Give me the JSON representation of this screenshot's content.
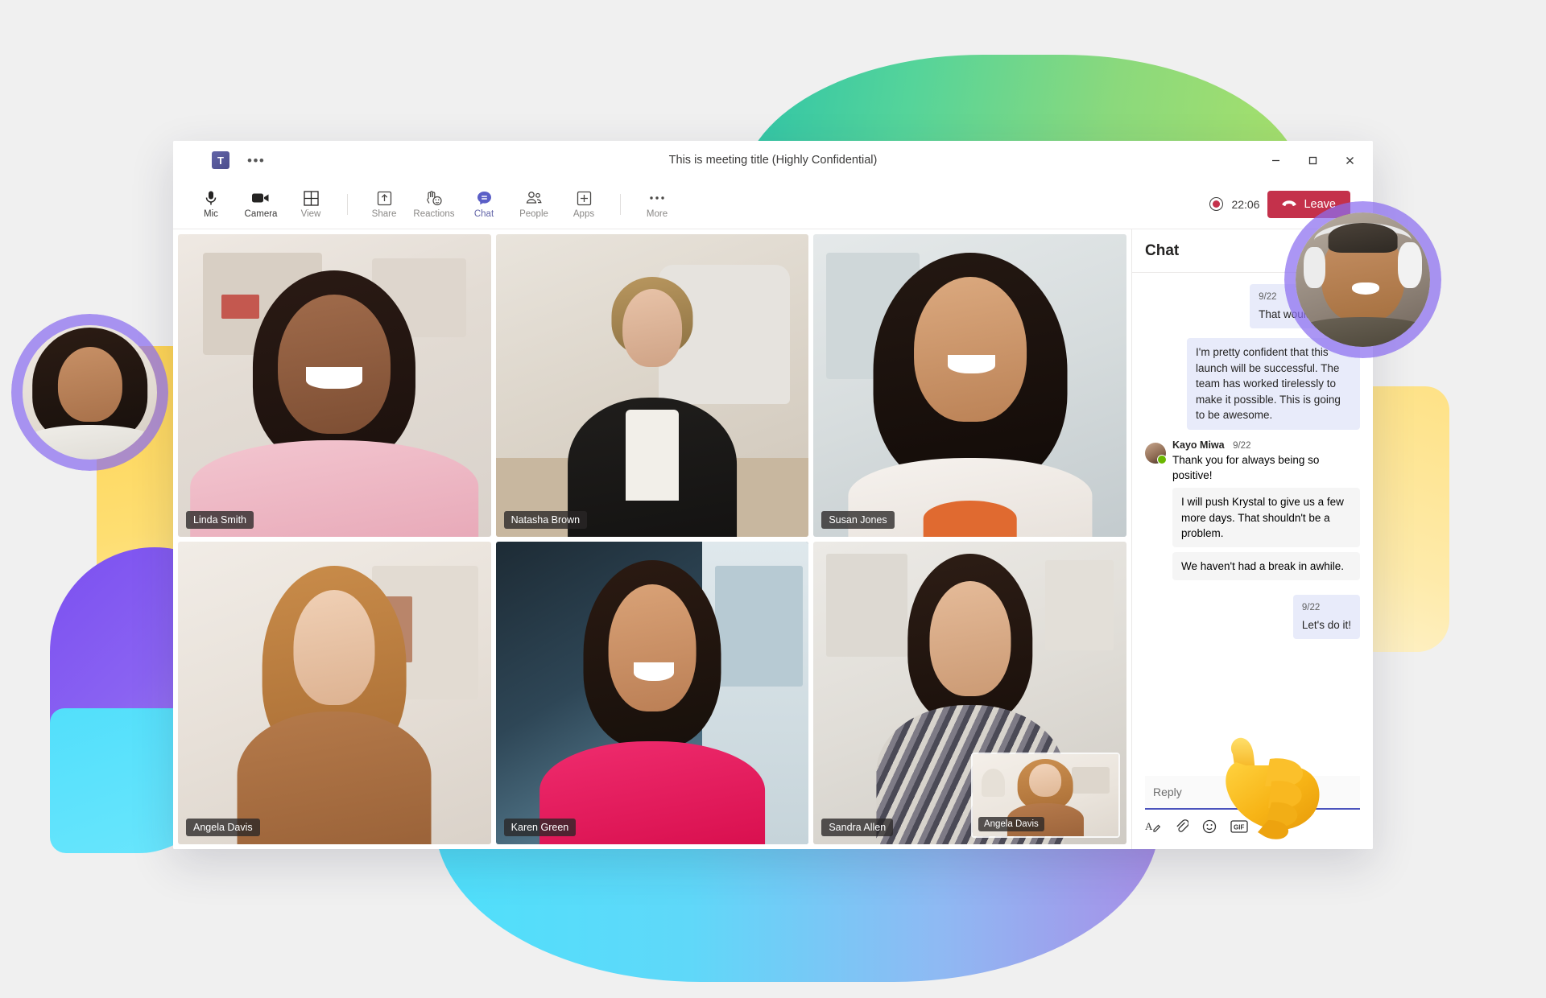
{
  "window": {
    "title": "This is meeting title (Highly Confidential)",
    "logo_label": "T",
    "overflow_label": "•••",
    "controls": {
      "minimize": "minimize-button",
      "maximize": "maximize-button",
      "close": "close-button"
    }
  },
  "toolbar": {
    "items": [
      {
        "label": "Mic",
        "icon": "microphone-icon",
        "state": "normal"
      },
      {
        "label": "Camera",
        "icon": "camera-icon",
        "state": "normal"
      },
      {
        "label": "View",
        "icon": "grid-view-icon",
        "state": "dim"
      },
      {
        "label": "Share",
        "icon": "share-icon",
        "state": "dim"
      },
      {
        "label": "Reactions",
        "icon": "reactions-icon",
        "state": "dim"
      },
      {
        "label": "Chat",
        "icon": "chat-icon",
        "state": "active"
      },
      {
        "label": "People",
        "icon": "people-icon",
        "state": "dim"
      },
      {
        "label": "Apps",
        "icon": "apps-plus-icon",
        "state": "dim"
      },
      {
        "label": "More",
        "icon": "more-icon",
        "state": "dim"
      }
    ],
    "timer": "22:06",
    "recording_icon": "recording-indicator-icon",
    "leave_label": "Leave",
    "leave_icon": "phone-hangup-icon",
    "leave_color": "#c4314b",
    "accent_color": "#6264a7"
  },
  "video_grid": {
    "participants": [
      {
        "name": "Linda Smith"
      },
      {
        "name": "Natasha Brown"
      },
      {
        "name": "Susan Jones"
      },
      {
        "name": "Angela Davis"
      },
      {
        "name": "Karen Green"
      },
      {
        "name": "Sandra Allen"
      }
    ],
    "pip": {
      "name": "Angela Davis"
    }
  },
  "chat": {
    "title": "Chat",
    "more_icon": "more-options-icon",
    "close_icon": "close-panel-icon",
    "messages": [
      {
        "direction": "out",
        "timestamp": "9/22",
        "text": "That would be right"
      },
      {
        "direction": "out",
        "timestamp": "",
        "text": "I'm pretty confident that this launch will be successful. The team has worked tirelessly to make it possible. This is going to be awesome."
      },
      {
        "direction": "in",
        "sender": "Kayo Miwa",
        "timestamp": "9/22",
        "text": "Thank you for always being so positive!",
        "presence": "available"
      },
      {
        "direction": "in",
        "sender": "",
        "timestamp": "",
        "text": "I will push Krystal to give us a few more days. That shouldn't be a problem."
      },
      {
        "direction": "in",
        "sender": "",
        "timestamp": "",
        "text": "We haven't had a break in awhile."
      },
      {
        "direction": "out",
        "timestamp": "9/22",
        "text": "Let's do it!"
      }
    ],
    "composer": {
      "placeholder": "Reply",
      "icons": [
        {
          "name": "format-text-icon",
          "glyph": "A"
        },
        {
          "name": "attach-file-icon",
          "glyph": "📎"
        },
        {
          "name": "emoji-icon",
          "glyph": "☺"
        },
        {
          "name": "giphy-icon",
          "glyph": "GIF"
        },
        {
          "name": "sticker-icon",
          "glyph": "★"
        }
      ]
    }
  },
  "decor": {
    "reaction_emoji": "thumbs-up-emoji",
    "floating_avatar_left": "floating-avatar-woman",
    "floating_avatar_right": "floating-avatar-man-headphones",
    "colors": {
      "green_blob": "#55d49a",
      "blue_blob": "#5fd8f9",
      "yellow_blob": "#ffd24a",
      "purple_blob": "#7b4ff0",
      "ring_purple": "#8a6ef0"
    }
  }
}
